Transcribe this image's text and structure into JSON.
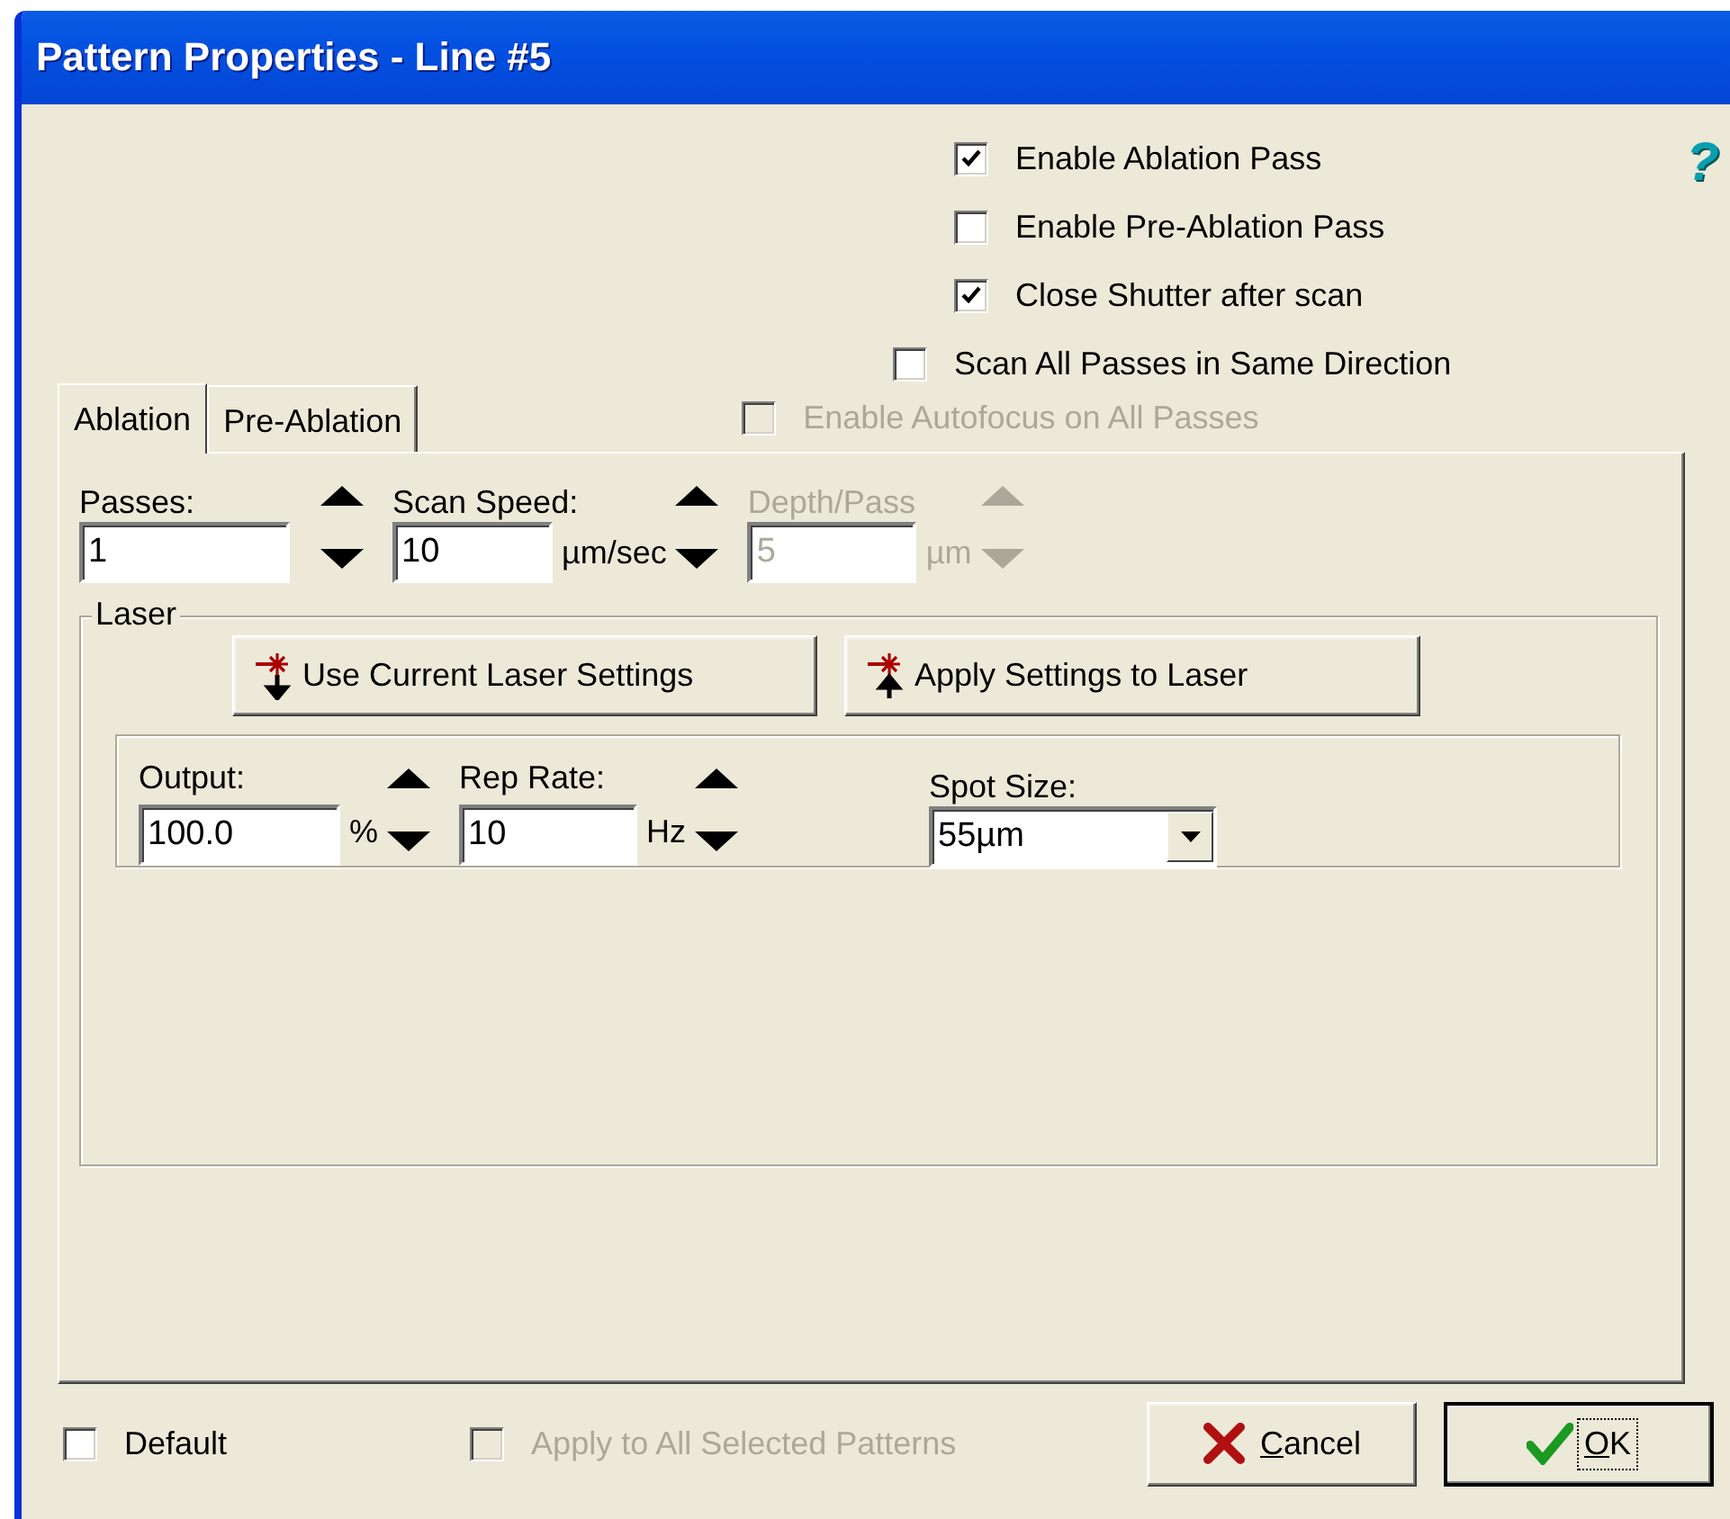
{
  "window": {
    "title": "Pattern Properties - Line #5",
    "help": "?"
  },
  "options": [
    {
      "label": "Enable Ablation Pass",
      "checked": true,
      "disabled": false
    },
    {
      "label": "Enable Pre-Ablation Pass",
      "checked": false,
      "disabled": false
    },
    {
      "label": "Close Shutter after scan",
      "checked": true,
      "disabled": false
    }
  ],
  "pass_options": [
    {
      "label": "Scan All Passes in Same Direction",
      "checked": false,
      "disabled": false
    },
    {
      "label": "Enable Autofocus on All Passes",
      "checked": false,
      "disabled": true
    }
  ],
  "tabs": [
    {
      "label": "Ablation",
      "selected": true
    },
    {
      "label": "Pre-Ablation",
      "selected": false
    }
  ],
  "scan_fields": [
    {
      "label": "Passes:",
      "value": "1",
      "disabled": false
    },
    {
      "label": "Scan Speed:",
      "value": "10",
      "unit": "µm/sec",
      "disabled": false
    },
    {
      "label": "Depth/Pass",
      "value": "5",
      "unit": "µm",
      "disabled": true
    }
  ],
  "laser": {
    "title": "Laser",
    "buttons": [
      {
        "label": "Use Current Laser Settings",
        "kind": "down"
      },
      {
        "label": "Apply Settings to Laser",
        "kind": "up"
      }
    ],
    "fields": [
      {
        "label": "Output:",
        "value": "100.0",
        "unit": "%",
        "disabled": false
      },
      {
        "label": "Rep Rate:",
        "value": "10",
        "unit": "Hz",
        "disabled": false
      }
    ],
    "spot_size": {
      "label": "Spot Size:",
      "value": "55µm"
    }
  },
  "footer": {
    "options": [
      {
        "label": "Default",
        "checked": false,
        "disabled": false
      },
      {
        "label": "Apply to All Selected Patterns",
        "checked": false,
        "disabled": true
      }
    ],
    "buttons": [
      {
        "label": "Cancel",
        "kind": "cancel",
        "focused": false
      },
      {
        "label": "OK",
        "kind": "ok",
        "focused": true
      }
    ]
  }
}
